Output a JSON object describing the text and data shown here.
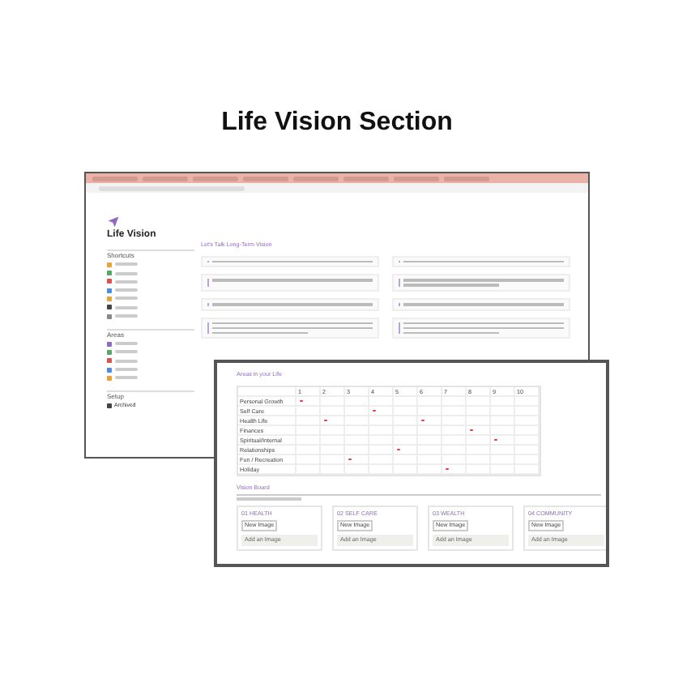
{
  "heading": "Life Vision Section",
  "back_window": {
    "page_title": "Life Vision",
    "sidebar": [
      {
        "title": "Shortcuts",
        "items": [
          {
            "color": "#e8a33c"
          },
          {
            "color": "#5aa469"
          },
          {
            "color": "#d9534f"
          },
          {
            "color": "#4a90d9"
          },
          {
            "color": "#e8a33c"
          },
          {
            "color": "#444444"
          },
          {
            "color": "#888888"
          }
        ]
      },
      {
        "title": "Areas",
        "items": [
          {
            "color": "#8e6bbf"
          },
          {
            "color": "#5aa469"
          },
          {
            "color": "#d9534f"
          },
          {
            "color": "#4a90d9"
          },
          {
            "color": "#e8a33c"
          }
        ]
      },
      {
        "title": "Setup",
        "items": [
          {
            "color": "#444444",
            "label": "Archived"
          }
        ]
      }
    ],
    "section_title": "Let's Talk Long-Term Vision",
    "question_cards": [
      {
        "kind": "short"
      },
      {
        "kind": "short"
      },
      {
        "kind": "short"
      },
      {
        "kind": "tall"
      },
      {
        "kind": "short"
      },
      {
        "kind": "medium"
      },
      {
        "kind": "short"
      },
      {
        "kind": "tall"
      }
    ]
  },
  "front_window": {
    "table_title": "Areas in your Life",
    "columns": [
      "1",
      "2",
      "3",
      "4",
      "5",
      "6",
      "7",
      "8",
      "9",
      "10"
    ],
    "rows": [
      {
        "label": "Personal Growth",
        "cells": [
          {
            "marked": true
          },
          {
            "marked": false
          },
          {
            "marked": false
          },
          {
            "marked": false
          },
          {
            "marked": false
          },
          {
            "marked": false
          },
          {
            "marked": false
          },
          {
            "marked": false
          },
          {
            "marked": false
          },
          {
            "marked": false
          }
        ]
      },
      {
        "label": "Self Care",
        "cells": [
          {
            "marked": false
          },
          {
            "marked": false
          },
          {
            "marked": false
          },
          {
            "marked": true
          },
          {
            "marked": false
          },
          {
            "marked": false
          },
          {
            "marked": false
          },
          {
            "marked": false
          },
          {
            "marked": false
          },
          {
            "marked": false
          }
        ]
      },
      {
        "label": "Health Life",
        "cells": [
          {
            "marked": false
          },
          {
            "marked": true
          },
          {
            "marked": false
          },
          {
            "marked": false
          },
          {
            "marked": false
          },
          {
            "marked": true
          },
          {
            "marked": false
          },
          {
            "marked": false
          },
          {
            "marked": false
          },
          {
            "marked": false
          }
        ]
      },
      {
        "label": "Finances",
        "cells": [
          {
            "marked": false
          },
          {
            "marked": false
          },
          {
            "marked": false
          },
          {
            "marked": false
          },
          {
            "marked": false
          },
          {
            "marked": false
          },
          {
            "marked": false
          },
          {
            "marked": true
          },
          {
            "marked": false
          },
          {
            "marked": false
          }
        ]
      },
      {
        "label": "Spiritual/Internal",
        "cells": [
          {
            "marked": false
          },
          {
            "marked": false
          },
          {
            "marked": false
          },
          {
            "marked": false
          },
          {
            "marked": false
          },
          {
            "marked": false
          },
          {
            "marked": false
          },
          {
            "marked": false
          },
          {
            "marked": true
          },
          {
            "marked": false
          }
        ]
      },
      {
        "label": "Relationships",
        "cells": [
          {
            "marked": false
          },
          {
            "marked": false
          },
          {
            "marked": false
          },
          {
            "marked": false
          },
          {
            "marked": true
          },
          {
            "marked": false
          },
          {
            "marked": false
          },
          {
            "marked": false
          },
          {
            "marked": false
          },
          {
            "marked": false
          }
        ]
      },
      {
        "label": "Fun / Recreation",
        "cells": [
          {
            "marked": false
          },
          {
            "marked": false
          },
          {
            "marked": true
          },
          {
            "marked": false
          },
          {
            "marked": false
          },
          {
            "marked": false
          },
          {
            "marked": false
          },
          {
            "marked": false
          },
          {
            "marked": false
          },
          {
            "marked": false
          }
        ]
      },
      {
        "label": "Holiday",
        "cells": [
          {
            "marked": false
          },
          {
            "marked": false
          },
          {
            "marked": false
          },
          {
            "marked": false
          },
          {
            "marked": false
          },
          {
            "marked": false
          },
          {
            "marked": true
          },
          {
            "marked": false
          },
          {
            "marked": false
          },
          {
            "marked": false
          }
        ]
      }
    ],
    "board_title": "Vision Board",
    "board_cards": [
      {
        "label": "01 HEALTH",
        "button": "New Image",
        "add": "Add an Image"
      },
      {
        "label": "02 SELF CARE",
        "button": "New Image",
        "add": "Add an Image"
      },
      {
        "label": "03 WEALTH",
        "button": "New Image",
        "add": "Add an Image"
      },
      {
        "label": "04 COMMUNITY",
        "button": "New Image",
        "add": "Add an Image"
      }
    ]
  }
}
